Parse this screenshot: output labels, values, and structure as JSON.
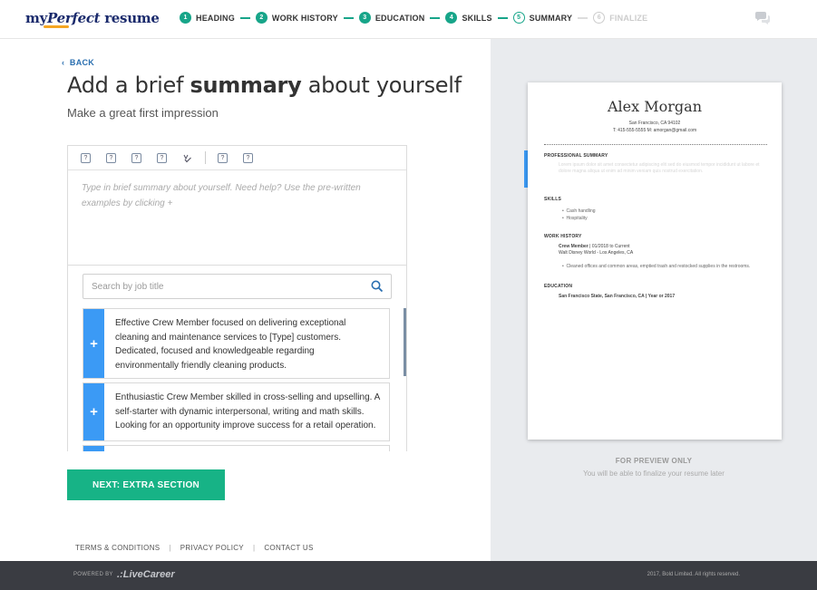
{
  "logo": {
    "my": "my",
    "perfect": "Perfect",
    "resume": " resume"
  },
  "steps": [
    {
      "num": "1",
      "label": "HEADING",
      "state": "done"
    },
    {
      "num": "2",
      "label": "WORK HISTORY",
      "state": "done"
    },
    {
      "num": "3",
      "label": "EDUCATION",
      "state": "done"
    },
    {
      "num": "4",
      "label": "SKILLS",
      "state": "done"
    },
    {
      "num": "5",
      "label": "SUMMARY",
      "state": "current"
    },
    {
      "num": "6",
      "label": "FINALIZE",
      "state": "disabled"
    }
  ],
  "main": {
    "back_label": "BACK",
    "title_pre": "Add a brief ",
    "title_bold": "summary",
    "title_post": " about yourself",
    "subtitle": "Make a great first impression",
    "editor_placeholder": "Type in brief summary about yourself. Need help? Use the pre-written examples by clicking +",
    "toolbar_icons": [
      "bold-icon",
      "italic-icon",
      "underline-icon",
      "list-icon",
      "spellcheck-icon",
      "undo-icon",
      "redo-icon"
    ],
    "search_placeholder": "Search by job title",
    "examples": [
      {
        "plus": "+",
        "text": "Effective Crew Member focused on delivering exceptional cleaning and maintenance services to [Type] customers. Dedicated, focused and knowledgeable regarding environmentally friendly cleaning products."
      },
      {
        "plus": "+",
        "text": "Enthusiastic Crew Member skilled in cross-selling and upselling. A self-starter with dynamic interpersonal, writing and math skills. Looking for an opportunity improve success for a retail operation."
      }
    ],
    "next_button": "NEXT: EXTRA SECTION"
  },
  "footer_links": [
    "TERMS & CONDITIONS",
    "PRIVACY POLICY",
    "CONTACT US"
  ],
  "preview": {
    "name": "Alex Morgan",
    "location": "San Francisco, CA 94102",
    "contact": "T: 415-555-5555 M: amorgan@gmail.com",
    "summary_heading": "PROFESSIONAL SUMMARY",
    "summary_placeholder": "Lorem ipsum dolor sit amet consectetur adipiscing elit sed do eiusmod tempor incididunt ut labore et dolore magna aliqua ut enim ad minim veniam quis nostrud exercitation.",
    "skills_heading": "SKILLS",
    "skills": [
      "Cash handling",
      "Hospitality"
    ],
    "work_heading": "WORK HISTORY",
    "job_title": "Crew Member",
    "job_dates": " | 01/2018 to Current",
    "job_company": "Walt Disney World - Los Angeles, CA",
    "job_bullet": "Cleaned offices and common areas, emptied trash and restocked supplies in the restrooms.",
    "education_heading": "EDUCATION",
    "education_line": "San Francisco State, San Francisco, CA | Year or 2017",
    "preview_only": "FOR PREVIEW ONLY",
    "preview_note": "You will be able to finalize your resume later"
  },
  "footer": {
    "powered_by": "POWERED BY",
    "brand": "LiveCareer",
    "copyright": "2017, Bold Limited. All rights reserved."
  },
  "colors": {
    "accent_green": "#17b386",
    "accent_blue": "#3b9af5",
    "footer_bg": "#3a3c42"
  }
}
